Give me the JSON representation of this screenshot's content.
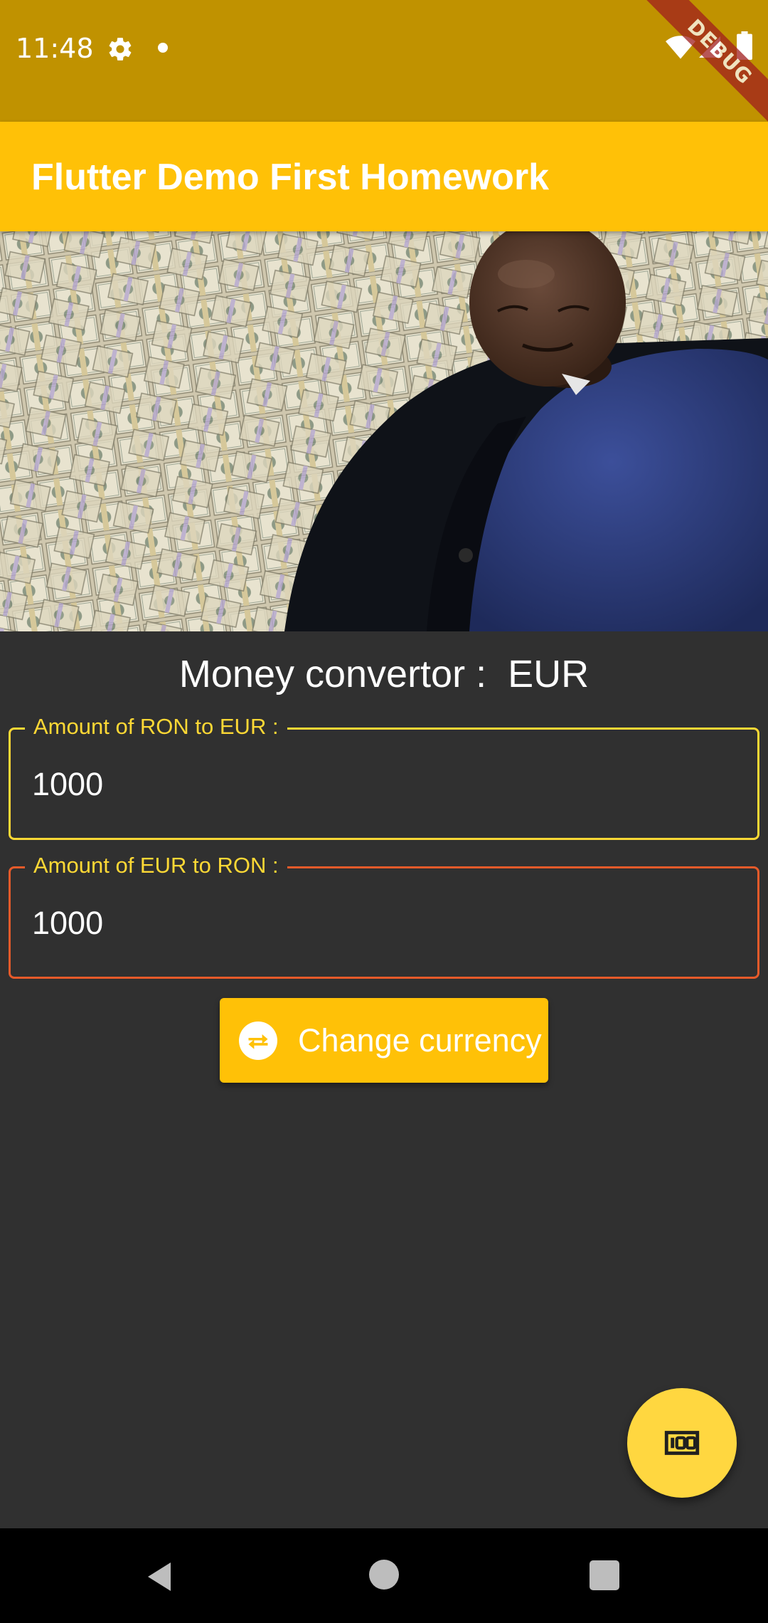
{
  "status_bar": {
    "time": "11:48",
    "debug_banner": "DEBUG",
    "icons": [
      "gear-icon",
      "notification-dot-icon",
      "wifi-icon",
      "signal-icon",
      "battery-icon"
    ]
  },
  "app_bar": {
    "title": "Flutter Demo First Homework",
    "color": "#ffc107"
  },
  "hero_image": {
    "description_icon": "money-pile-photo"
  },
  "converter": {
    "title": "Money convertor :  EUR",
    "fields": [
      {
        "label": "Amount of RON to EUR :",
        "value": "1000",
        "border_color": "#fdd835"
      },
      {
        "label": "Amount of EUR to RON :",
        "value": "1000",
        "border_color": "#e65a2a"
      }
    ],
    "change_button_label": "Change currency",
    "change_button_icon": "swap-horiz-circle-icon"
  },
  "fab": {
    "icon": "money-100-icon"
  },
  "nav_bar": {
    "icons": [
      "back-icon",
      "home-icon",
      "recents-icon"
    ]
  },
  "colors": {
    "status_bar": "#c09200",
    "background": "#303030",
    "accent": "#ffc107",
    "fab": "#ffd740"
  }
}
